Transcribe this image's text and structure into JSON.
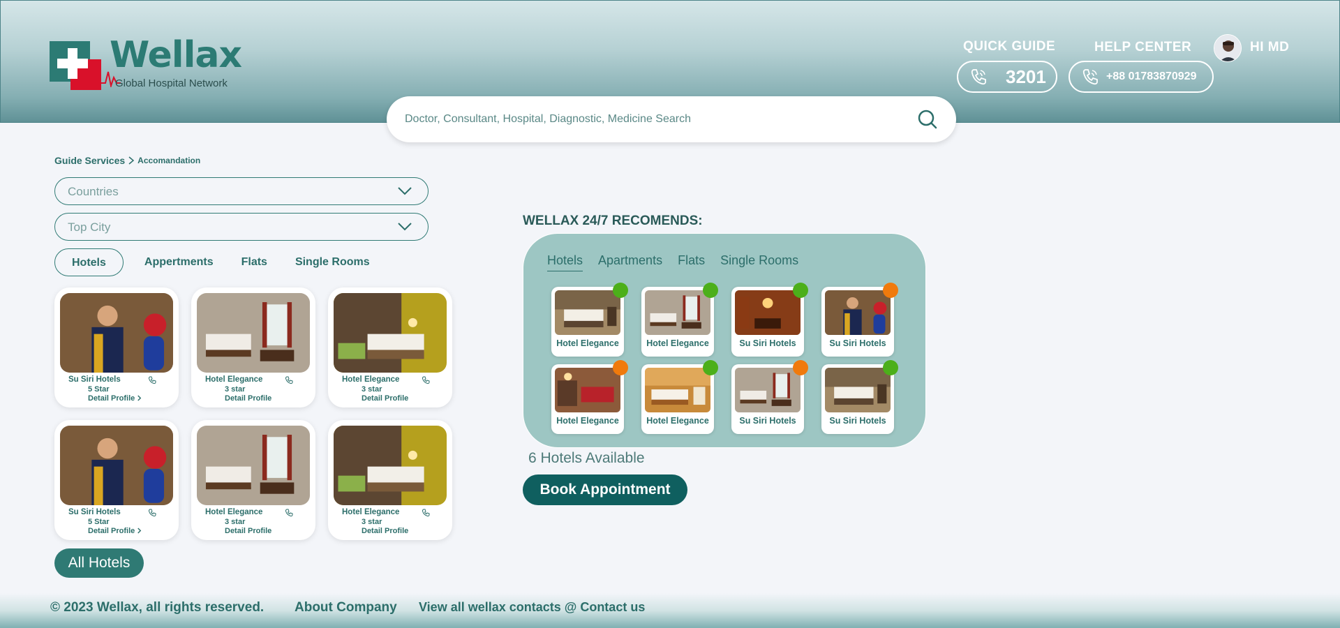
{
  "brand": {
    "name": "Wellax",
    "tagline": "Global Hospital Network"
  },
  "header": {
    "quick_guide": "QUICK GUIDE",
    "help_center": "HELP CENTER",
    "greeting": "HI MD",
    "quick_number": "3201",
    "help_number": "+88 01783870929"
  },
  "search": {
    "placeholder": "Doctor, Consultant, Hospital, Diagnostic, Medicine Search"
  },
  "breadcrumb": {
    "root": "Guide Services",
    "current": "Accomandation"
  },
  "filters": {
    "country_placeholder": "Countries",
    "city_placeholder": "Top City"
  },
  "tabs": [
    "Hotels",
    "Appertments",
    "Flats",
    "Single Rooms"
  ],
  "listings": [
    {
      "name": "Su Siri Hotels",
      "rating": "5 Star",
      "detail": "Detail Profile",
      "has_chevron": true,
      "image": "reception"
    },
    {
      "name": "Hotel Elegance",
      "rating": "3 star",
      "detail": "Detail Profile",
      "has_chevron": false,
      "image": "room-dark"
    },
    {
      "name": "Hotel Elegance",
      "rating": "3 star",
      "detail": "Detail Profile",
      "has_chevron": false,
      "image": "room-yellow"
    },
    {
      "name": "Su Siri Hotels",
      "rating": "5 Star",
      "detail": "Detail Profile",
      "has_chevron": true,
      "image": "reception"
    },
    {
      "name": "Hotel Elegance",
      "rating": "3 star",
      "detail": "Detail Profile",
      "has_chevron": false,
      "image": "room-dark"
    },
    {
      "name": "Hotel Elegance",
      "rating": "3 star",
      "detail": "Detail Profile",
      "has_chevron": false,
      "image": "room-yellow"
    }
  ],
  "all_hotels_label": "All Hotels",
  "recommends": {
    "title": "WELLAX 24/7 RECOMENDS:",
    "tabs": [
      "Hotels",
      "Apartments",
      "Flats",
      "Single Rooms"
    ],
    "items": [
      {
        "name": "Hotel Elegance",
        "status": "green",
        "image": "room-light"
      },
      {
        "name": "Hotel Elegance",
        "status": "green",
        "image": "room-dark"
      },
      {
        "name": "Su Siri Hotels",
        "status": "green",
        "image": "lobby"
      },
      {
        "name": "Su Siri Hotels",
        "status": "orange",
        "image": "reception"
      },
      {
        "name": "Hotel Elegance",
        "status": "orange",
        "image": "lobby-red"
      },
      {
        "name": "Hotel Elegance",
        "status": "green",
        "image": "room-orange"
      },
      {
        "name": "Su Siri Hotels",
        "status": "orange",
        "image": "room-dark"
      },
      {
        "name": "Su Siri Hotels",
        "status": "green",
        "image": "room-light"
      }
    ],
    "available": "6 Hotels Available",
    "book_label": "Book Appointment"
  },
  "colors": {
    "accent": "#2f7a74",
    "dark_accent": "#0f5f5f",
    "green_status": "#4caf1a",
    "orange_status": "#f07a0c",
    "panel": "#9dc6c3"
  },
  "footer": {
    "copyright": "© 2023 Wellax, all rights reserved.",
    "about": "About Company",
    "contacts": "View all wellax contacts @ Contact us"
  }
}
